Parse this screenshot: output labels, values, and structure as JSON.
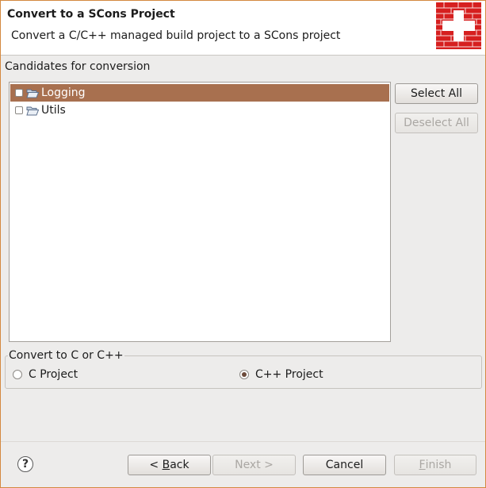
{
  "header": {
    "title": "Convert to a SCons Project",
    "description": "Convert a C/C++ managed build project to a SCons project"
  },
  "candidates": {
    "label": "Candidates for conversion",
    "items": [
      {
        "label": "Logging",
        "checked": false,
        "selected": true
      },
      {
        "label": "Utils",
        "checked": false,
        "selected": false
      }
    ]
  },
  "side_buttons": {
    "select_all": "Select All",
    "deselect_all": "Deselect All"
  },
  "language_group": {
    "legend": "Convert to C or C++",
    "options": [
      {
        "label": "C Project",
        "selected": false
      },
      {
        "label": "C++ Project",
        "selected": true
      }
    ]
  },
  "footer": {
    "help_icon": "?",
    "back_mnemonic": "B",
    "back_rest": "ack",
    "back_prefix": "< ",
    "next": "Next >",
    "cancel": "Cancel",
    "finish_mnemonic": "F",
    "finish_rest": "inish"
  },
  "colors": {
    "selection": "#a8704f",
    "logo_red": "#d61f1f",
    "window_border": "#d4893f"
  }
}
